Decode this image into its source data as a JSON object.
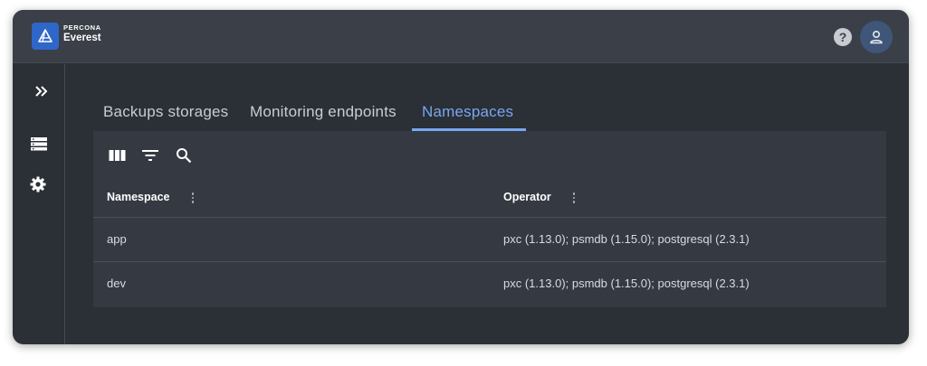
{
  "app": {
    "brand": "PERCONA",
    "product": "Everest",
    "logo_icon": "percona-triangle-icon",
    "help_icon": "help-circle-icon",
    "avatar_icon": "user-icon"
  },
  "sidebar": {
    "items": [
      {
        "icon": "double-chevron-right-icon"
      },
      {
        "icon": "database-list-icon"
      },
      {
        "icon": "gear-icon"
      }
    ]
  },
  "tabs": [
    {
      "label": "Backups storages",
      "active": false
    },
    {
      "label": "Monitoring endpoints",
      "active": false
    },
    {
      "label": "Namespaces",
      "active": true
    }
  ],
  "toolbar": {
    "icons": [
      "columns-icon",
      "filter-icon",
      "search-icon"
    ]
  },
  "table": {
    "columns": [
      "Namespace",
      "Operator"
    ],
    "rows": [
      {
        "namespace": "app",
        "operator": "pxc (1.13.0); psmdb (1.15.0); postgresql (2.3.1)"
      },
      {
        "namespace": "dev",
        "operator": "pxc (1.13.0); psmdb (1.15.0); postgresql (2.3.1)"
      }
    ]
  },
  "colors": {
    "accent": "#77a7f2",
    "background": "#2b2f36",
    "topbar": "#3b3f47",
    "panel": "#353a42",
    "logo": "#2f66c9",
    "avatar": "#3f5679"
  }
}
